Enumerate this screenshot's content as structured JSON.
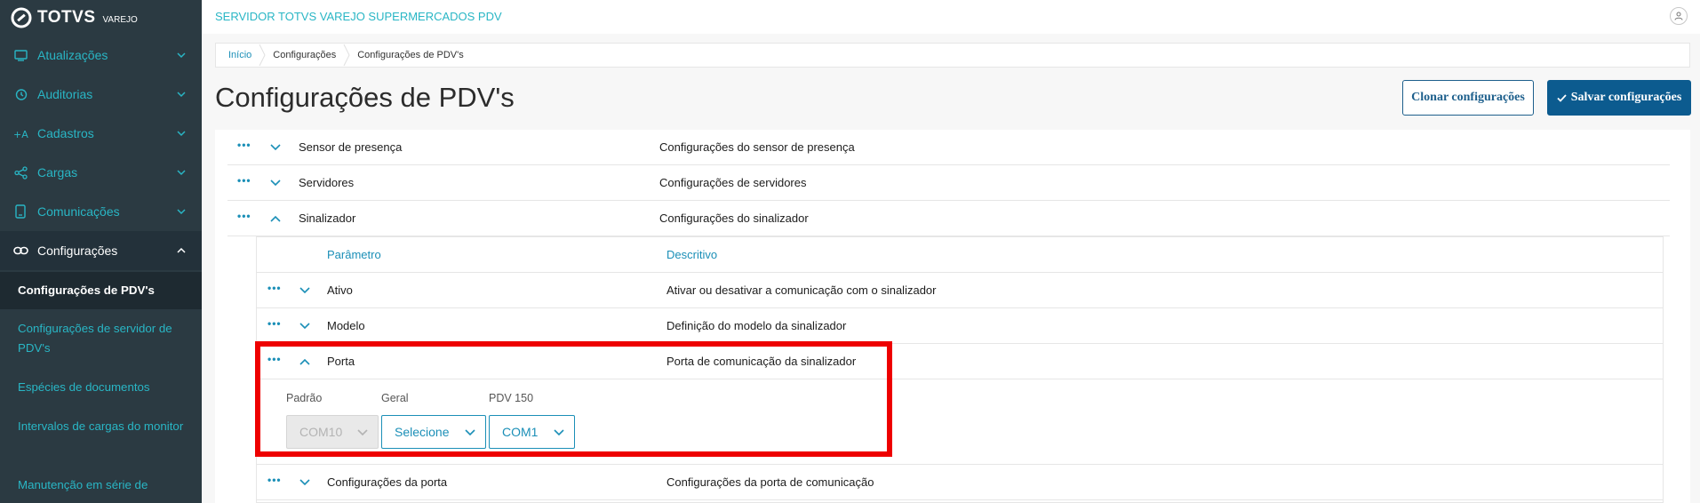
{
  "brand": {
    "name": "TOTVS",
    "sub": "VAREJO"
  },
  "sidebar": {
    "items": [
      {
        "label": "Atualizações",
        "icon": "monitor-icon"
      },
      {
        "label": "Auditorias",
        "icon": "history-icon"
      },
      {
        "label": "Cadastros",
        "icon": "add-user-icon"
      },
      {
        "label": "Cargas",
        "icon": "share-icon"
      },
      {
        "label": "Comunicações",
        "icon": "phone-icon"
      },
      {
        "label": "Configurações",
        "icon": "link-icon"
      }
    ],
    "subitems": [
      "Configurações de PDV's",
      "Configurações de servidor de PDV's",
      "Espécies de documentos",
      "Intervalos de cargas do monitor",
      "Manutenção em série de"
    ]
  },
  "topbar": {
    "server_title": "SERVIDOR TOTVS VAREJO SUPERMERCADOS PDV"
  },
  "breadcrumb": [
    "Início",
    "Configurações",
    "Configurações de PDV's"
  ],
  "page": {
    "title": "Configurações de PDV's"
  },
  "buttons": {
    "clone": "Clonar configurações",
    "save": "Salvar configurações"
  },
  "rows": [
    {
      "name": "Sensor de presença",
      "desc": "Configurações do sensor de presença",
      "expanded": false
    },
    {
      "name": "Servidores",
      "desc": "Configurações de servidores",
      "expanded": false
    },
    {
      "name": "Sinalizador",
      "desc": "Configurações do sinalizador",
      "expanded": true
    }
  ],
  "inner": {
    "headers": {
      "param": "Parâmetro",
      "desc": "Descritivo"
    },
    "rows": [
      {
        "name": "Ativo",
        "desc": "Ativar ou desativar a comunicação com o sinalizador"
      },
      {
        "name": "Modelo",
        "desc": "Definição do modelo da sinalizador"
      },
      {
        "name": "Porta",
        "desc": "Porta de comunicação da sinalizador"
      },
      {
        "name": "Configurações da porta",
        "desc": "Configurações da porta de comunicação"
      }
    ],
    "porta_fields": {
      "labels": [
        "Padrão",
        "Geral",
        "PDV 150"
      ],
      "values": [
        "COM10",
        "Selecione",
        "COM1"
      ]
    }
  },
  "dots": "•••",
  "colors": {
    "accent": "#29b6c5",
    "primary": "#0c5b8f",
    "sidebar": "#2b3a42",
    "highlight": "#ee0000"
  }
}
